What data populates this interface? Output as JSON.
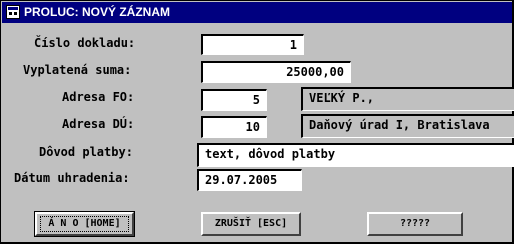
{
  "window": {
    "title": "PROLUC: NOVÝ ZÁZNAM",
    "icon": "app-window-icon"
  },
  "form": {
    "cislo_dokladu": {
      "label": "Číslo dokladu:",
      "value": "1"
    },
    "vyplatena_suma": {
      "label": "Vyplatená suma:",
      "value": "25000,00"
    },
    "adresa_fo": {
      "label": "Adresa FO:",
      "value": "5",
      "ref": "VEĽKÝ P.,"
    },
    "adresa_du": {
      "label": "Adresa DÚ:",
      "value": "10",
      "ref": "Daňový úrad I, Bratislava"
    },
    "dovod_platby": {
      "label": "Dôvod platby:",
      "value": "text, dôvod platby"
    },
    "datum_uhradenia": {
      "label": "Dátum uhradenia:",
      "value": "29.07.2005"
    }
  },
  "buttons": {
    "ano": "Á N O [HOME]",
    "zrusit": "ZRUŠIŤ [ESC]",
    "other": "?????"
  },
  "colors": {
    "titlebar": "#000080",
    "background": "#c0c0c0"
  }
}
